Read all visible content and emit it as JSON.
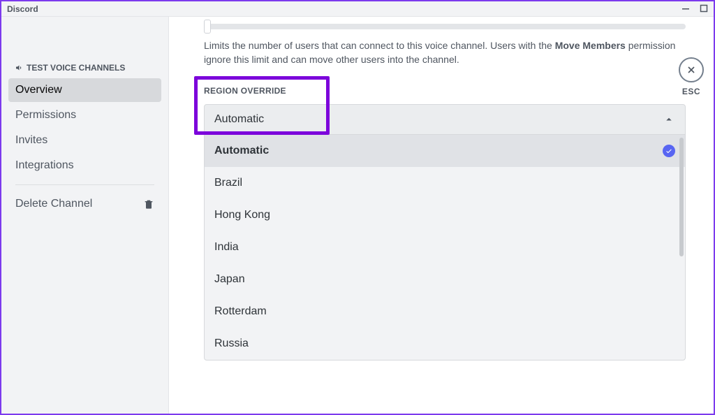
{
  "titlebar": {
    "title": "Discord"
  },
  "sidebar": {
    "header": "TEST VOICE CHANNELS",
    "items": [
      {
        "label": "Overview",
        "active": true
      },
      {
        "label": "Permissions",
        "active": false
      },
      {
        "label": "Invites",
        "active": false
      },
      {
        "label": "Integrations",
        "active": false
      }
    ],
    "delete_label": "Delete Channel"
  },
  "content": {
    "description_prefix": "Limits the number of users that can connect to this voice channel. Users with the ",
    "description_bold": "Move Members",
    "description_suffix": " permission ignore this limit and can move other users into the channel.",
    "region_label": "REGION OVERRIDE",
    "dropdown_selected": "Automatic",
    "dropdown_options": [
      {
        "label": "Automatic",
        "selected": true
      },
      {
        "label": "Brazil",
        "selected": false
      },
      {
        "label": "Hong Kong",
        "selected": false
      },
      {
        "label": "India",
        "selected": false
      },
      {
        "label": "Japan",
        "selected": false
      },
      {
        "label": "Rotterdam",
        "selected": false
      },
      {
        "label": "Russia",
        "selected": false
      }
    ]
  },
  "esc": {
    "label": "ESC"
  }
}
